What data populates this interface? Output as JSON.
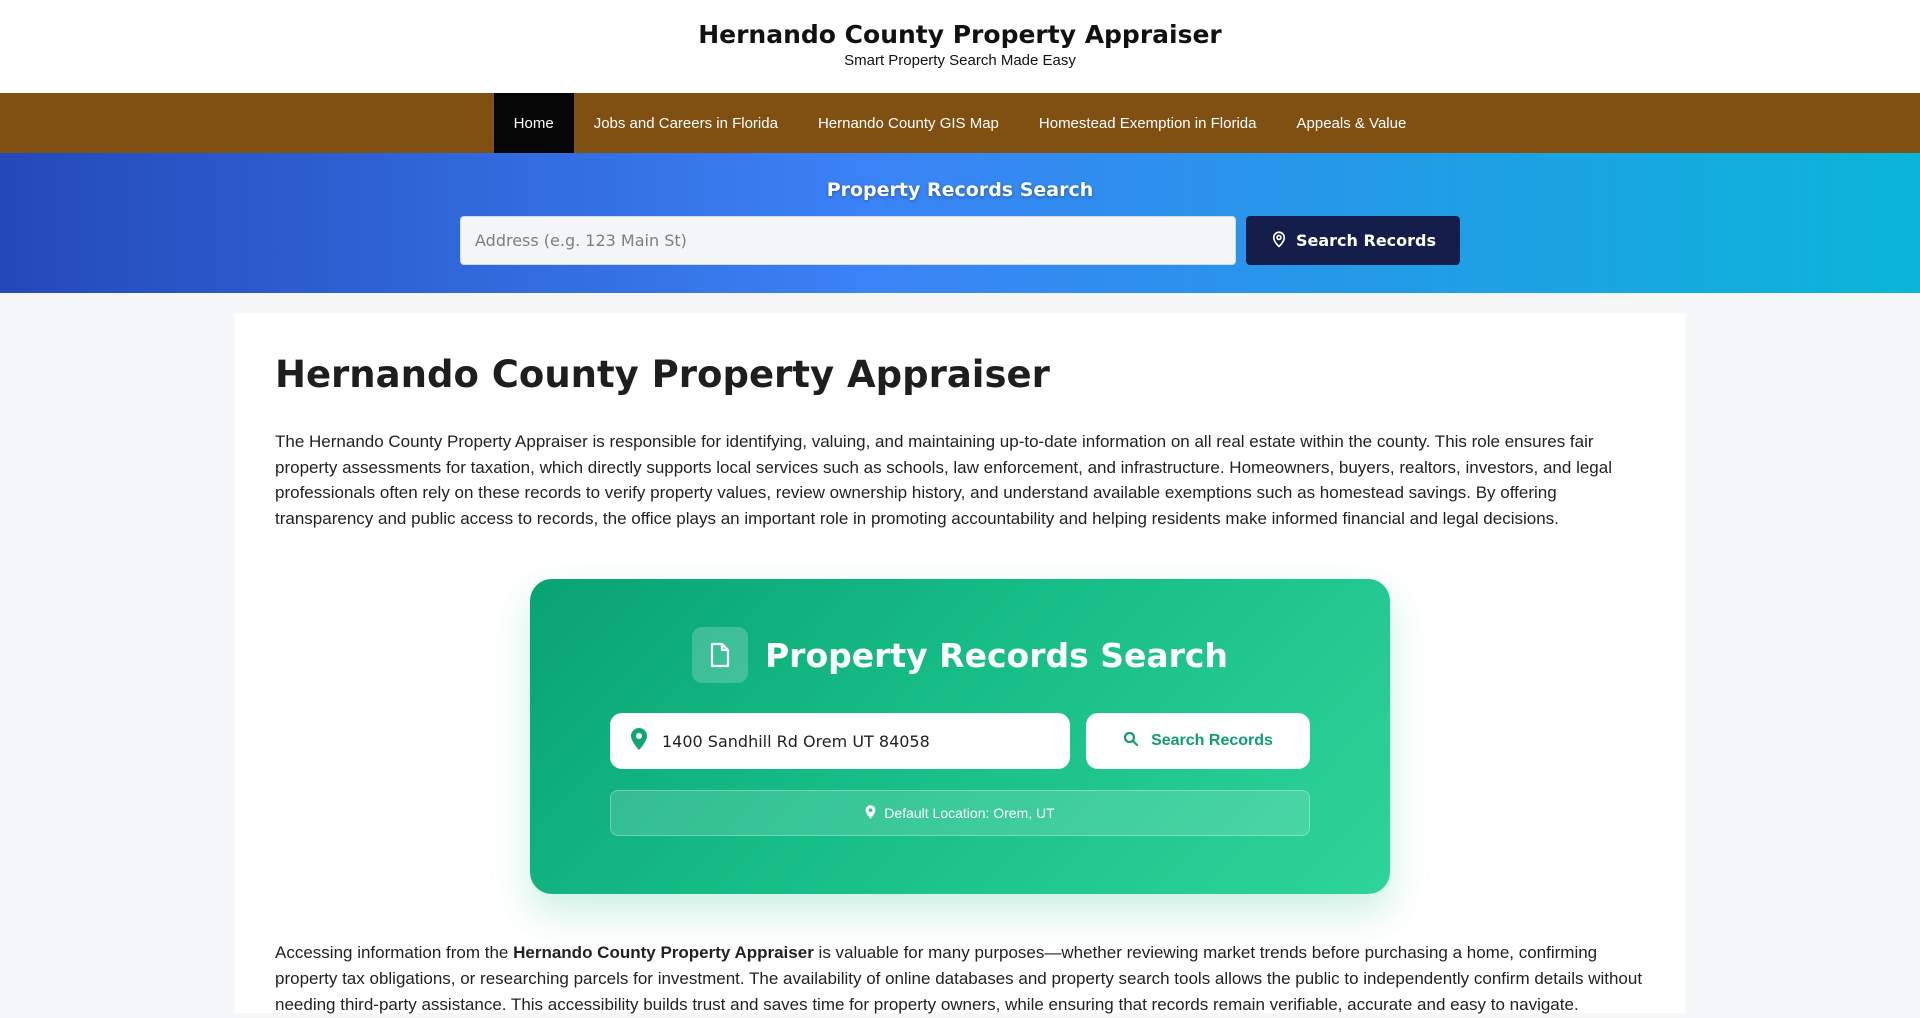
{
  "header": {
    "title": "Hernando County Property Appraiser",
    "tagline": "Smart Property Search Made Easy"
  },
  "nav": {
    "items": [
      {
        "label": "Home",
        "active": true
      },
      {
        "label": "Jobs and Careers in Florida"
      },
      {
        "label": "Hernando County GIS Map"
      },
      {
        "label": "Homestead Exemption in Florida"
      },
      {
        "label": "Appeals & Value"
      }
    ]
  },
  "hero": {
    "title": "Property Records Search",
    "placeholder": "Address (e.g. 123 Main St)",
    "button_label": "Search Records",
    "button_icon": "location-pin-icon"
  },
  "article": {
    "heading": "Hernando County Property Appraiser",
    "intro": "The Hernando County Property Appraiser is responsible for identifying, valuing, and maintaining up-to-date information on all real estate within the county. This role ensures fair property assessments for taxation, which directly supports local services such as schools, law enforcement, and infrastructure. Homeowners, buyers, realtors, investors, and legal professionals often rely on these records to verify property values, review ownership history, and understand available exemptions such as homestead savings. By offering transparency and public access to records, the office plays an important role in promoting accountability and helping residents make informed financial and legal decisions.",
    "outro_prefix": "Accessing information from the ",
    "outro_bold": "Hernando County Property Appraiser",
    "outro_suffix": " is valuable for many purposes—whether reviewing market trends before purchasing a home, confirming property tax obligations, or researching parcels for investment. The availability of online databases and property search tools allows the public to independently confirm details without needing third-party assistance. This accessibility builds trust and saves time for property owners, while ensuring that records remain verifiable, accurate and easy to navigate."
  },
  "search_card": {
    "title": "Property Records Search",
    "title_icon": "document-icon",
    "address_value": "1400 Sandhill Rd Orem UT 84058",
    "address_icon": "map-pin-icon",
    "button_label": "Search Records",
    "button_icon": "search-icon",
    "default_location": "Default Location: Orem, UT"
  },
  "colors": {
    "nav_bg": "#805013",
    "nav_active": "#050505",
    "hero_button": "#151e4a",
    "card_green": "#10b981"
  }
}
